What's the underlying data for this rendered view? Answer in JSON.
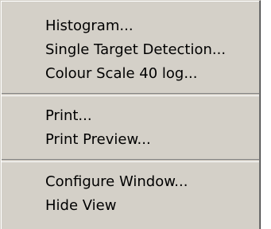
{
  "menu": {
    "group1": [
      {
        "label": "Histogram..."
      },
      {
        "label": "Single Target Detection..."
      },
      {
        "label": "Colour Scale 40 log..."
      }
    ],
    "group2": [
      {
        "label": "Print..."
      },
      {
        "label": "Print Preview..."
      }
    ],
    "group3": [
      {
        "label": "Configure Window..."
      },
      {
        "label": "Hide View"
      }
    ]
  }
}
